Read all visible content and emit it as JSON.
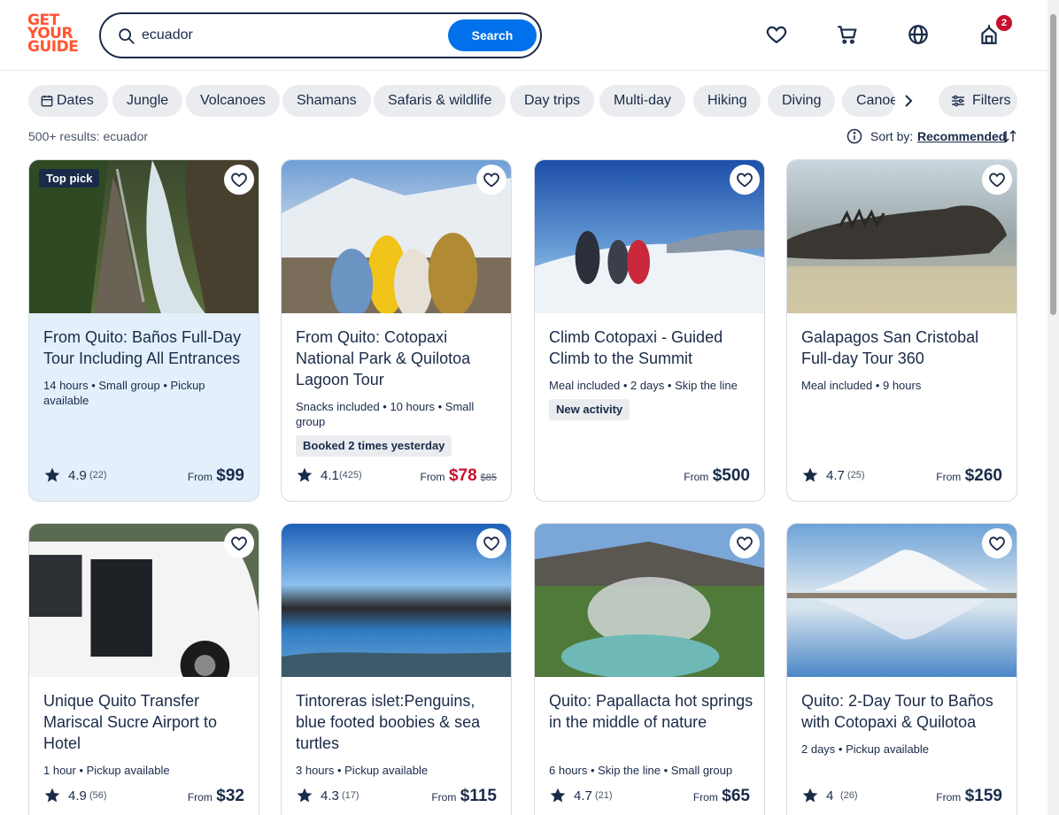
{
  "logo": {
    "line1": "GET",
    "line2": "YOUR",
    "line3": "GUIDE"
  },
  "search": {
    "value": "ecuador",
    "button": "Search"
  },
  "header": {
    "cart_badge": "2"
  },
  "chips": [
    "Dates",
    "Jungle",
    "Volcanoes",
    "Shamans",
    "Safaris & wildlife",
    "Day trips",
    "Multi-day",
    "Hiking",
    "Diving",
    "Canoe"
  ],
  "filters": "Filters",
  "results_text": "500+ results: ecuador",
  "sort": {
    "label": "Sort by:",
    "value": "Recommended"
  },
  "cards": [
    {
      "title": "From Quito: Baños Full-Day Tour Including All Entrances",
      "meta": "14 hours • Small group • Pickup available",
      "badge": "Top pick",
      "tag": "",
      "rating": "4.9",
      "reviews": "(22)",
      "from": "From",
      "price": "$99",
      "old_price": ""
    },
    {
      "title": "From Quito: Cotopaxi National Park & Quilotoa Lagoon Tour",
      "meta": "Snacks included • 10 hours • Small group",
      "badge": "",
      "tag": "Booked 2 times yesterday",
      "rating": "4.1",
      "reviews": "(425)",
      "from": "From",
      "price": "$78",
      "old_price": "$85"
    },
    {
      "title": "Climb Cotopaxi - Guided Climb to the Summit",
      "meta": "Meal included • 2 days • Skip the line",
      "badge": "",
      "tag": "New activity",
      "rating": "",
      "reviews": "",
      "from": "From",
      "price": "$500",
      "old_price": ""
    },
    {
      "title": "Galapagos San Cristobal Full-day Tour 360",
      "meta": "Meal included • 9 hours",
      "badge": "",
      "tag": "",
      "rating": "4.7",
      "reviews": "(25)",
      "from": "From",
      "price": "$260",
      "old_price": ""
    },
    {
      "title": "Unique Quito Transfer Mariscal Sucre Airport to Hotel",
      "meta": "1 hour • Pickup available",
      "badge": "",
      "tag": "",
      "rating": "4.9",
      "reviews": "(56)",
      "from": "From",
      "price": "$32",
      "old_price": ""
    },
    {
      "title": "Tintoreras islet:Penguins, blue footed boobies & sea turtles",
      "meta": "3 hours • Pickup available",
      "badge": "",
      "tag": "",
      "rating": "4.3",
      "reviews": "(17)",
      "from": "From",
      "price": "$115",
      "old_price": ""
    },
    {
      "title": "Quito: Papallacta hot springs in the middle of nature",
      "meta": "6 hours • Skip the line • Small group",
      "badge": "",
      "tag": "",
      "rating": "4.7",
      "reviews": "(21)",
      "from": "From",
      "price": "$65",
      "old_price": ""
    },
    {
      "title": "Quito: 2-Day Tour to Baños with Cotopaxi & Quilotoa",
      "meta": "2 days • Pickup available",
      "badge": "",
      "tag": "",
      "rating": "4",
      "reviews": "(26)",
      "from": "From",
      "price": "$159",
      "old_price": ""
    }
  ],
  "colors": {
    "brand": "#ff5533",
    "primary": "#0071eb",
    "text": "#1a2b49",
    "sale": "#c8102e",
    "highlight": "#e3f0fc"
  }
}
